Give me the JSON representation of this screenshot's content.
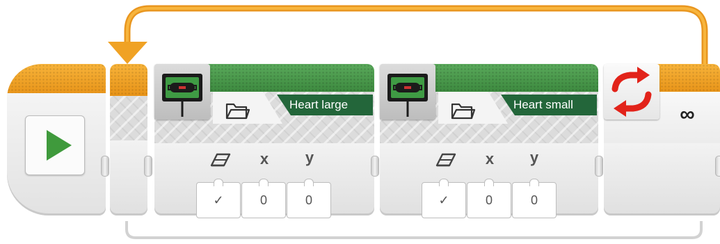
{
  "program": {
    "loop": {
      "count_symbol": "∞"
    },
    "blocks": [
      {
        "label": "Heart large",
        "params": {
          "headers": [
            "x",
            "y"
          ],
          "values": [
            "✓",
            "0",
            "0"
          ]
        }
      },
      {
        "label": "Heart small",
        "params": {
          "headers": [
            "x",
            "y"
          ],
          "values": [
            "✓",
            "0",
            "0"
          ]
        }
      }
    ]
  }
}
